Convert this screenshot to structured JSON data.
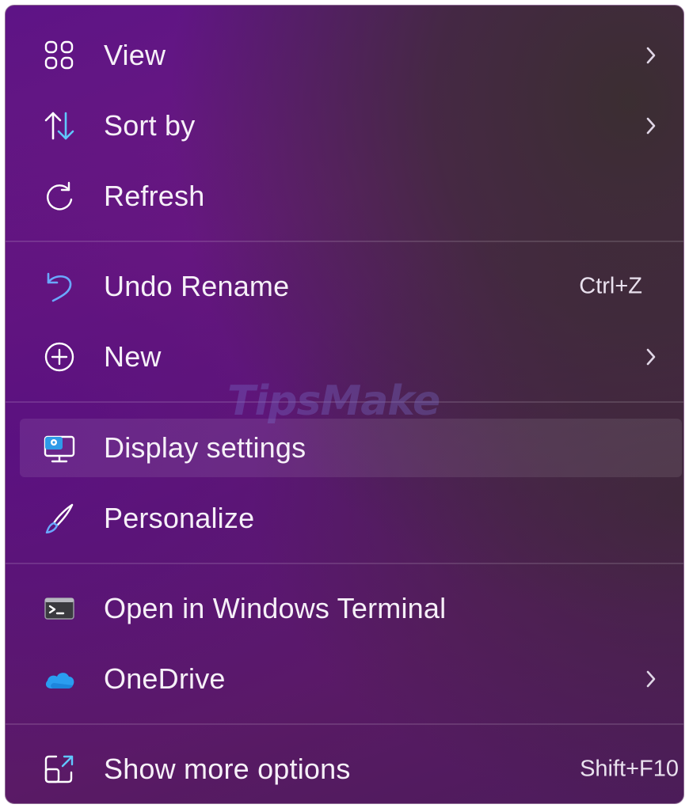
{
  "menu": {
    "items": [
      {
        "label": "View",
        "icon": "view-grid-icon",
        "submenu": true
      },
      {
        "label": "Sort by",
        "icon": "sort-arrows-icon",
        "submenu": true
      },
      {
        "label": "Refresh",
        "icon": "refresh-icon",
        "submenu": false
      },
      {
        "label": "Undo Rename",
        "icon": "undo-icon",
        "shortcut": "Ctrl+Z",
        "submenu": false
      },
      {
        "label": "New",
        "icon": "plus-circle-icon",
        "submenu": true
      },
      {
        "label": "Display settings",
        "icon": "display-settings-icon",
        "submenu": false,
        "hovered": true
      },
      {
        "label": "Personalize",
        "icon": "brush-icon",
        "submenu": false
      },
      {
        "label": "Open in Windows Terminal",
        "icon": "terminal-icon",
        "submenu": false
      },
      {
        "label": "OneDrive",
        "icon": "onedrive-cloud-icon",
        "submenu": true
      },
      {
        "label": "Show more options",
        "icon": "show-more-options-icon",
        "shortcut": "Shift+F10",
        "submenu": false
      }
    ]
  },
  "watermark": {
    "text": "TipsMake"
  },
  "colors": {
    "accent": "#60c8ff",
    "text": "#f6f0f8",
    "menu_background": "#5e1486"
  }
}
